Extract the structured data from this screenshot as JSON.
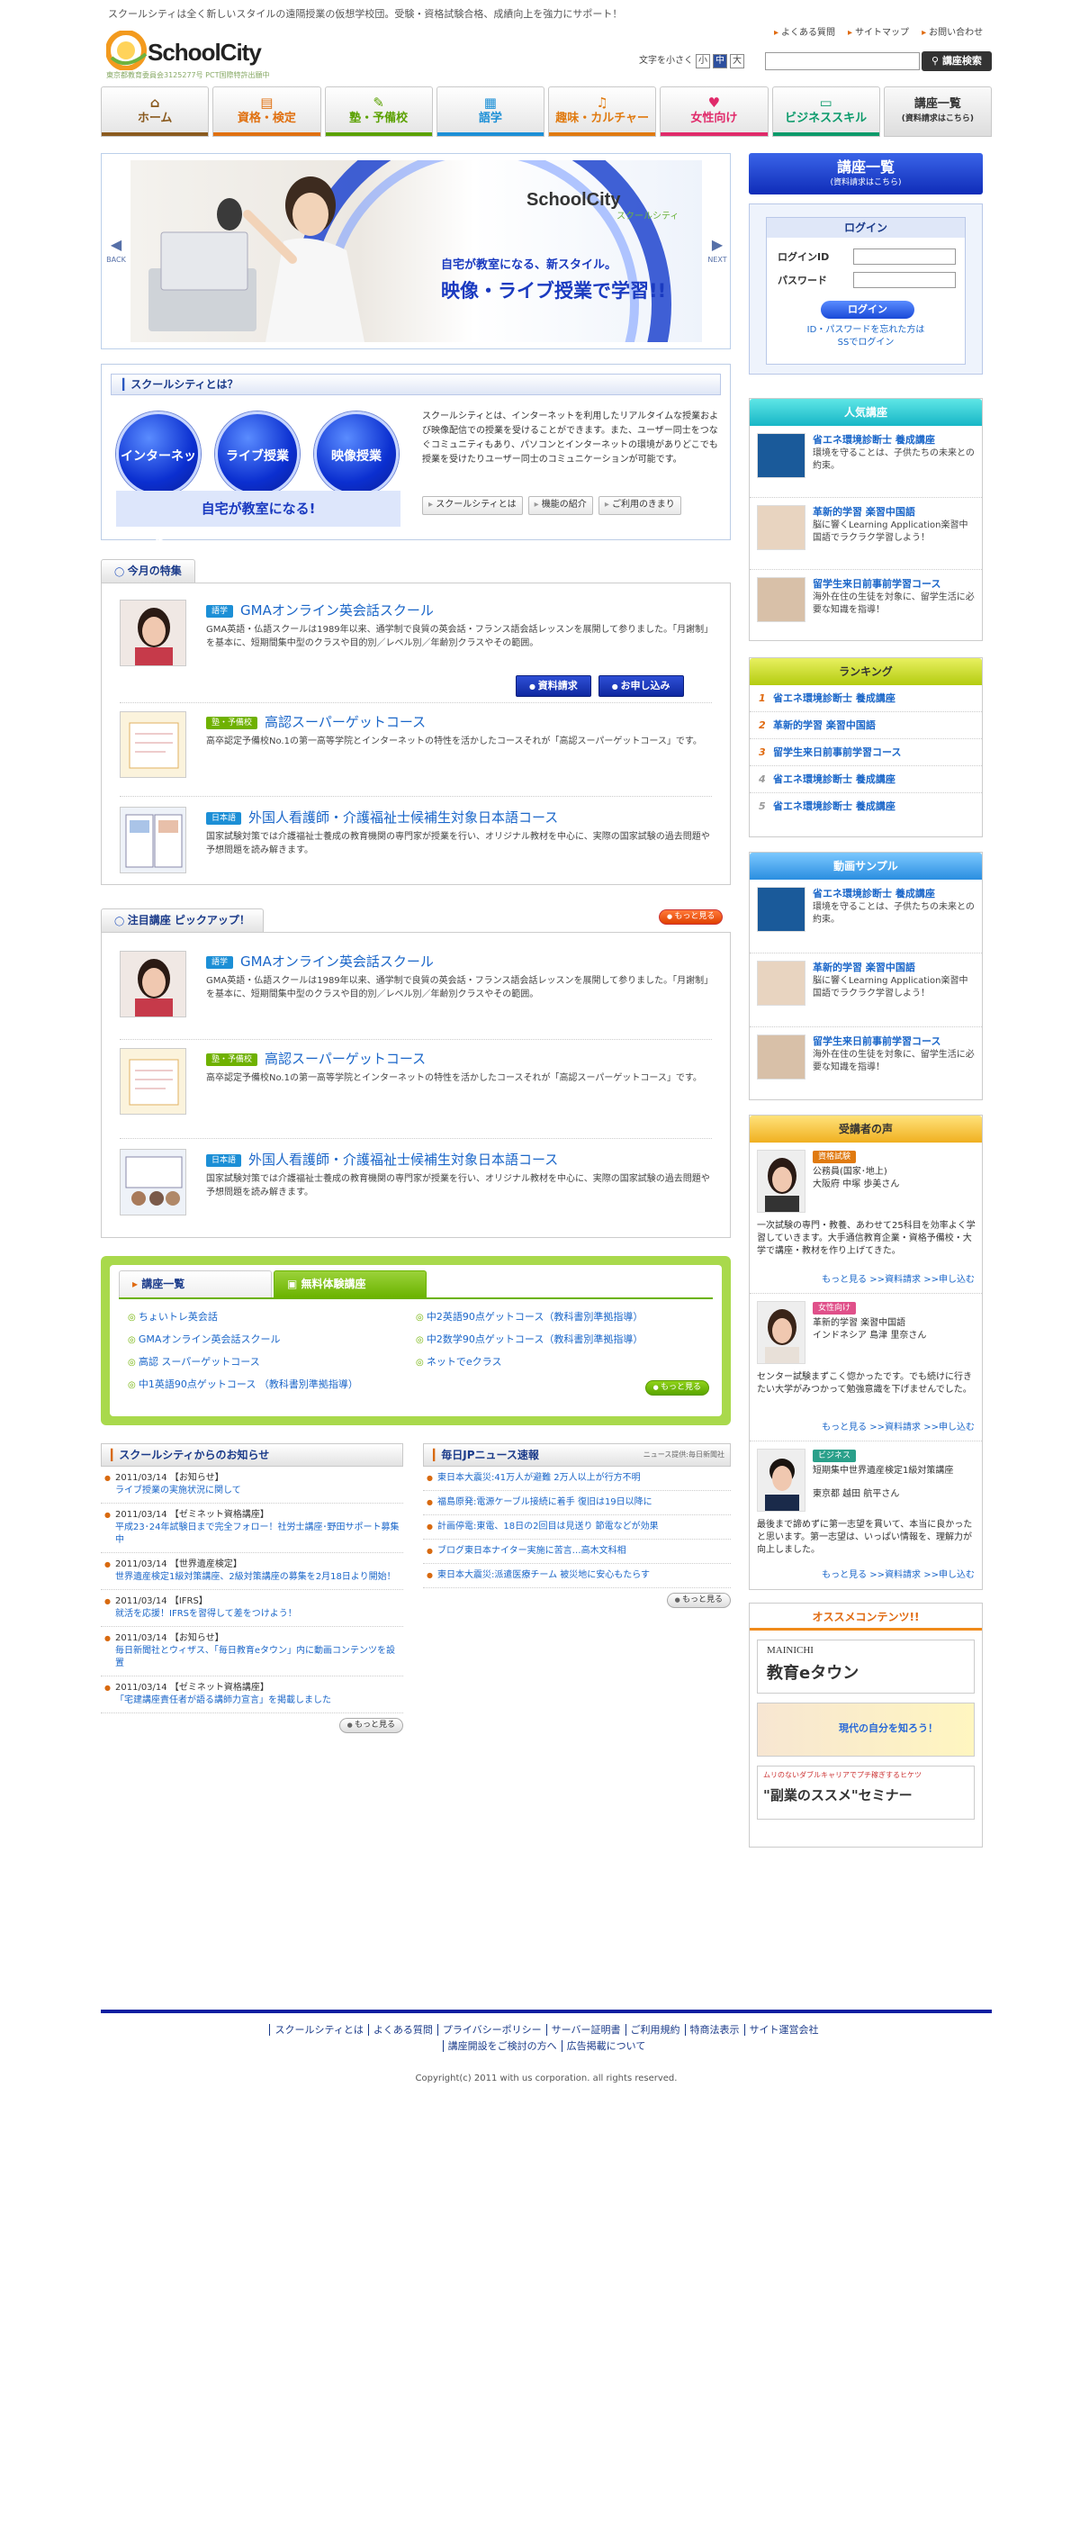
{
  "header": {
    "tagline": "スクールシティは全く新しいスタイルの遠隔授業の仮想学校団。受験・資格試験合格、成績向上を強力にサポート！",
    "logo_text": "SchoolCity",
    "logo_sub": "東京都教育委員会3125277号 PCT国際特許出願中",
    "toplinks": [
      "よくある質問",
      "サイトマップ",
      "お問い合わせ"
    ],
    "fontsize_label": "文字を小さく",
    "fontsize_options": [
      "小",
      "中",
      "大"
    ],
    "search_placeholder": "",
    "search_button": "講座検索"
  },
  "nav": [
    {
      "label": "ホーム",
      "icon": "home-icon",
      "color": "#8a5a1e"
    },
    {
      "label": "資格・検定",
      "icon": "certificate-icon",
      "color": "#e07010"
    },
    {
      "label": "塾・予備校",
      "icon": "pencil-icon",
      "color": "#5aa100"
    },
    {
      "label": "語学",
      "icon": "book-icon",
      "color": "#1c8fd6"
    },
    {
      "label": "趣味・カルチャー",
      "icon": "guitar-icon",
      "color": "#e07a10"
    },
    {
      "label": "女性向け",
      "icon": "heart-icon",
      "color": "#e02a6a"
    },
    {
      "label": "ビジネススキル",
      "icon": "computer-icon",
      "color": "#0a9a6a"
    }
  ],
  "nav_last": {
    "label": "講座一覧",
    "sub": "(資料請求はこちら)"
  },
  "hero": {
    "brand": "SchoolCity",
    "brand_kana": "スクールシティ",
    "line1": "自宅が教室になる、新スタイル。",
    "line2": "映像・ライブ授業で学習!!",
    "back": "BACK",
    "next": "NEXT"
  },
  "about": {
    "title": "スクールシティとは？",
    "circles": [
      "インターネット",
      "ライブ授業",
      "映像授業"
    ],
    "banner": "自宅が教室になる!",
    "text": "スクールシティとは、インターネットを利用したリアルタイムな授業および映像配信での授業を受けることができます。また、ユーザー同士をつなぐコミュニティもあり、パソコンとインターネットの環境がありどこでも授業を受けたりユーザー同士のコミュニケーションが可能です。",
    "buttons": [
      "スクールシティとは",
      "機能の紹介",
      "ご利用のきまり"
    ]
  },
  "featured": {
    "tab": "今月の特集",
    "items": [
      {
        "badge": "語学",
        "badge_color": "#1c8fd6",
        "title": "GMAオンライン英会話スクール",
        "desc": "GMA英語・仏語スクールは1989年以来、通学制で良質の英会話・フランス語会話レッスンを展開して参りました。「月謝制」を基本に、短期間集中型のクラスや目的別／レベル別／年齢別クラスやその範囲。"
      },
      {
        "badge": "塾・予備校",
        "badge_color": "#6fb100",
        "title": "高認スーパーゲットコース",
        "desc": "高卒認定予備校No.1の第一高等学院とインターネットの特性を活かしたコースそれが「高認スーパーゲットコース」です。"
      },
      {
        "badge": "日本語",
        "badge_color": "#1c8fd6",
        "title": "外国人看護師・介護福祉士候補生対象日本語コース",
        "desc": "国家試験対策では介護福祉士養成の教育機関の専門家が授業を行い、オリジナル教材を中心に、実際の国家試験の過去問題や予想問題を読み解きます。"
      }
    ],
    "btn_request": "資料請求",
    "btn_apply": "お申し込み"
  },
  "pickup": {
    "tab": "注目講座 ピックアップ！",
    "more": "もっと見る",
    "items": [
      {
        "badge": "語学",
        "badge_color": "#1c8fd6",
        "title": "GMAオンライン英会話スクール",
        "desc": "GMA英語・仏語スクールは1989年以来、通学制で良質の英会話・フランス語会話レッスンを展開して参りました。「月謝制」を基本に、短期間集中型のクラスや目的別／レベル別／年齢別クラスやその範囲。"
      },
      {
        "badge": "塾・予備校",
        "badge_color": "#6fb100",
        "title": "高認スーパーゲットコース",
        "desc": "高卒認定予備校No.1の第一高等学院とインターネットの特性を活かしたコースそれが「高認スーパーゲットコース」です。"
      },
      {
        "badge": "日本語",
        "badge_color": "#1c8fd6",
        "title": "外国人看護師・介護福祉士候補生対象日本語コース",
        "desc": "国家試験対策では介護福祉士養成の教育機関の専門家が授業を行い、オリジナル教材を中心に、実際の国家試験の過去問題や予想問題を読み解きます。"
      }
    ]
  },
  "courses": {
    "tab1": "講座一覧",
    "tab2": "無料体験講座",
    "left": [
      "ちょいトレ英会話",
      "GMAオンライン英会話スクール",
      "高認 スーパーゲットコース",
      "中1英語90点ゲットコース （教科書別準拠指導）"
    ],
    "right": [
      "中2英語90点ゲットコース（教科書別準拠指導）",
      "中2数学90点ゲットコース（教科書別準拠指導）",
      "ネットでeクラス"
    ],
    "more": "もっと見る"
  },
  "notices": {
    "title": "スクールシティからのお知らせ",
    "items": [
      {
        "meta": "2011/03/14 【お知らせ】",
        "text": "ライブ授業の実施状況に関して"
      },
      {
        "meta": "2011/03/14 【ゼミネット資格講座】",
        "text": "平成23･24年試験日まで完全フォロー！社労士講座･野田サポート募集中"
      },
      {
        "meta": "2011/03/14 【世界遺産検定】",
        "text": "世界遺産検定1級対策講座、2級対策講座の募集を2月18日より開始！"
      },
      {
        "meta": "2011/03/14 【IFRS】",
        "text": "就活を応援！IFRSを習得して差をつけよう！"
      },
      {
        "meta": "2011/03/14 【お知らせ】",
        "text": "毎日新聞社とウィザス、「毎日教育eタウン」内に動画コンテンツを設置"
      },
      {
        "meta": "2011/03/14 【ゼミネット資格講座】",
        "text": "「宅建講座責任者が語る講師力宣言」を掲載しました"
      }
    ],
    "more": "もっと見る"
  },
  "jpnews": {
    "title": "毎日JPニュース速報",
    "source": "ニュース提供:毎日新聞社",
    "items": [
      "東日本大震災:41万人が避難 2万人以上が行方不明",
      "福島原発:電源ケーブル接続に着手 復旧は19日以降に",
      "計画停電:東電、18日の2回目は見送り 節電などが効果",
      "ブログ東日本ナイター実施に苦言…高木文科相",
      "東日本大震災:派遣医療チーム 被災地に安心もたらす"
    ],
    "more": "もっと見る"
  },
  "sidebar": {
    "list_button": "講座一覧",
    "list_sub": "(資料請求はこちら)",
    "login_title": "ログイン",
    "login_id": "ログインID",
    "password": "パスワード",
    "login_btn": "ログイン",
    "forgot": "ID・パスワードを忘れた方は",
    "ss_login": "SSでログイン",
    "popular_title": "人気講座",
    "popular": [
      {
        "title": "省エネ環境診断士 養成講座",
        "desc": "環境を守ることは、子供たちの未来との約束。"
      },
      {
        "title": "革新的学習 楽習中国語",
        "desc": "脳に響くLearning Application楽習中国語でラクラク学習しよう！"
      },
      {
        "title": "留学生来日前事前学習コース",
        "desc": "海外在住の生徒を対象に、留学生活に必要な知識を指導！"
      }
    ],
    "ranking_title": "ランキング",
    "ranking": [
      "省エネ環境診断士 養成講座",
      "革新的学習 楽習中国語",
      "留学生来日前事前学習コース",
      "省エネ環境診断士 養成講座",
      "省エネ環境診断士 養成講座"
    ],
    "video_title": "動画サンプル",
    "video": [
      {
        "title": "省エネ環境診断士 養成講座",
        "desc": "環境を守ることは、子供たちの未来との約束。"
      },
      {
        "title": "革新的学習 楽習中国語",
        "desc": "脳に響くLearning Application楽習中国語でラクラク学習しよう！"
      },
      {
        "title": "留学生来日前事前学習コース",
        "desc": "海外在住の生徒を対象に、留学生活に必要な知識を指導！"
      }
    ],
    "voice_title": "受講者の声",
    "voices": [
      {
        "badge": "資格試験",
        "badge_color": "#e07a10",
        "job": "公務員(国家･地上)",
        "name": "大阪府 中塚 歩美さん",
        "text": "一次試験の専門・教養、あわせて25科目を効率よく学習していきます。大手通信教育企業・資格予備校・大学で講座・教材を作り上げてきた。"
      },
      {
        "badge": "女性向け",
        "badge_color": "#e0508a",
        "job": "革新的学習 楽習中国語",
        "name": "インドネシア 島津 里奈さん",
        "text": "センター試験まずこく惚かったです。でも続けに行きたい大学がみつかって勉強意識を下げませんでした。"
      },
      {
        "badge": "ビジネス",
        "badge_color": "#2aa08a",
        "job": "短期集中世界遺産検定1級対策講座",
        "name": "東京都 越田 航平さん",
        "text": "最後まで諦めずに第一志望を貫いて、本当に良かったと思います。第一志望は、いっぱい情報を、理解力が向上しました。"
      }
    ],
    "voice_links": [
      "もっと見る",
      "資料請求",
      "申し込む"
    ],
    "recommend_title": "オススメコンテンツ!!",
    "recommend": [
      {
        "top": "MAINICHI",
        "main": "教育eタウン"
      },
      {
        "top": "",
        "main": "現代の自分を知ろう！"
      },
      {
        "top": "ムリのないダブルキャリアでプチ稼ぎするヒケツ",
        "main": "\"副業のススメ\"セミナー"
      }
    ]
  },
  "footer": {
    "links1": [
      "スクールシティとは",
      "よくある質問",
      "プライバシーポリシー",
      "サーバー証明書",
      "ご利用規約",
      "特商法表示",
      "サイト運営会社"
    ],
    "links2": [
      "講座開設をご検討の方へ",
      "広告掲載について"
    ],
    "copyright": "Copyright(c) 2011 with us corporation. all rights reserved."
  }
}
